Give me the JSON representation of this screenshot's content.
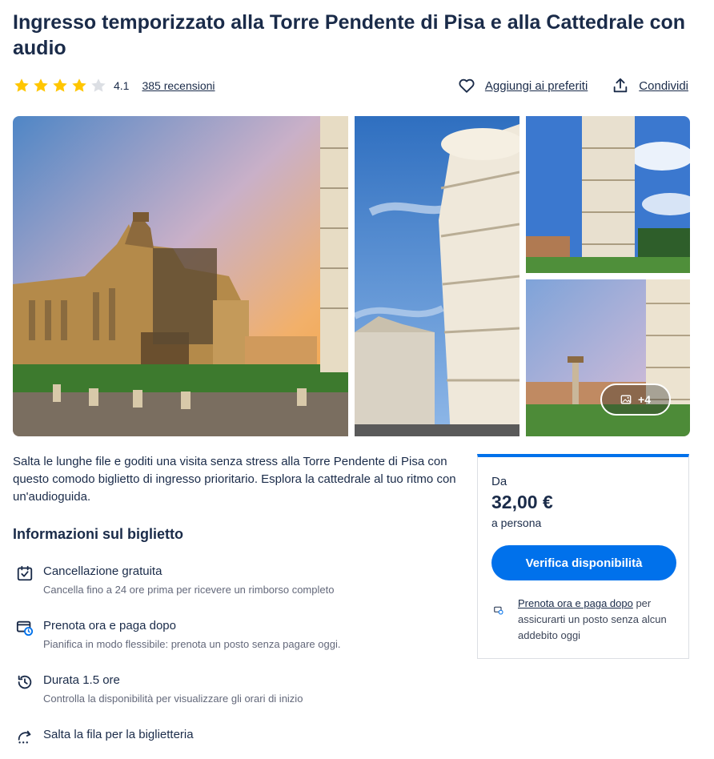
{
  "product": {
    "title": "Ingresso temporizzato alla Torre Pendente di Pisa e alla Cattedrale con audio",
    "rating": 4.1,
    "rating_text": "4.1",
    "stars_filled": 4,
    "stars_total": 5,
    "reviews_label": "385 recensioni"
  },
  "actions": {
    "wishlist_label": "Aggiungi ai preferiti",
    "share_label": "Condividi"
  },
  "gallery": {
    "more_label": "+4",
    "icons": [
      "image-icon"
    ]
  },
  "description": "Salta le lunghe file e goditi una visita senza stress alla Torre Pendente di Pisa con questo comodo biglietto di ingresso prioritario. Esplora la cattedrale al tuo ritmo con un'audioguida.",
  "ticket_info": {
    "title": "Informazioni sul biglietto",
    "features": [
      {
        "name": "Cancellazione gratuita",
        "desc": "Cancella fino a 24 ore prima per ricevere un rimborso completo",
        "icon": "calendar-check-icon"
      },
      {
        "name": "Prenota ora e paga dopo",
        "desc": "Pianifica in modo flessibile: prenota un posto senza pagare oggi.",
        "icon": "card-clock-icon"
      },
      {
        "name": "Durata 1.5 ore",
        "desc": "Controlla la disponibilità per visualizzare gli orari di inizio",
        "icon": "clock-history-icon"
      },
      {
        "name": "Salta la fila per la biglietteria",
        "desc": "",
        "icon": "skip-line-icon"
      }
    ]
  },
  "booking": {
    "from_label": "Da",
    "price": "32,00 €",
    "per_label": "a persona",
    "cta_label": "Verifica disponibilità",
    "pay_later_link": "Prenota ora e paga dopo",
    "pay_later_text": " per assicurarti un posto senza alcun addebito oggi"
  },
  "colors": {
    "primary": "#0071eb",
    "text": "#1a2b49",
    "muted": "#63687a",
    "star": "#ffc600",
    "star_empty": "#dcdfe4"
  }
}
